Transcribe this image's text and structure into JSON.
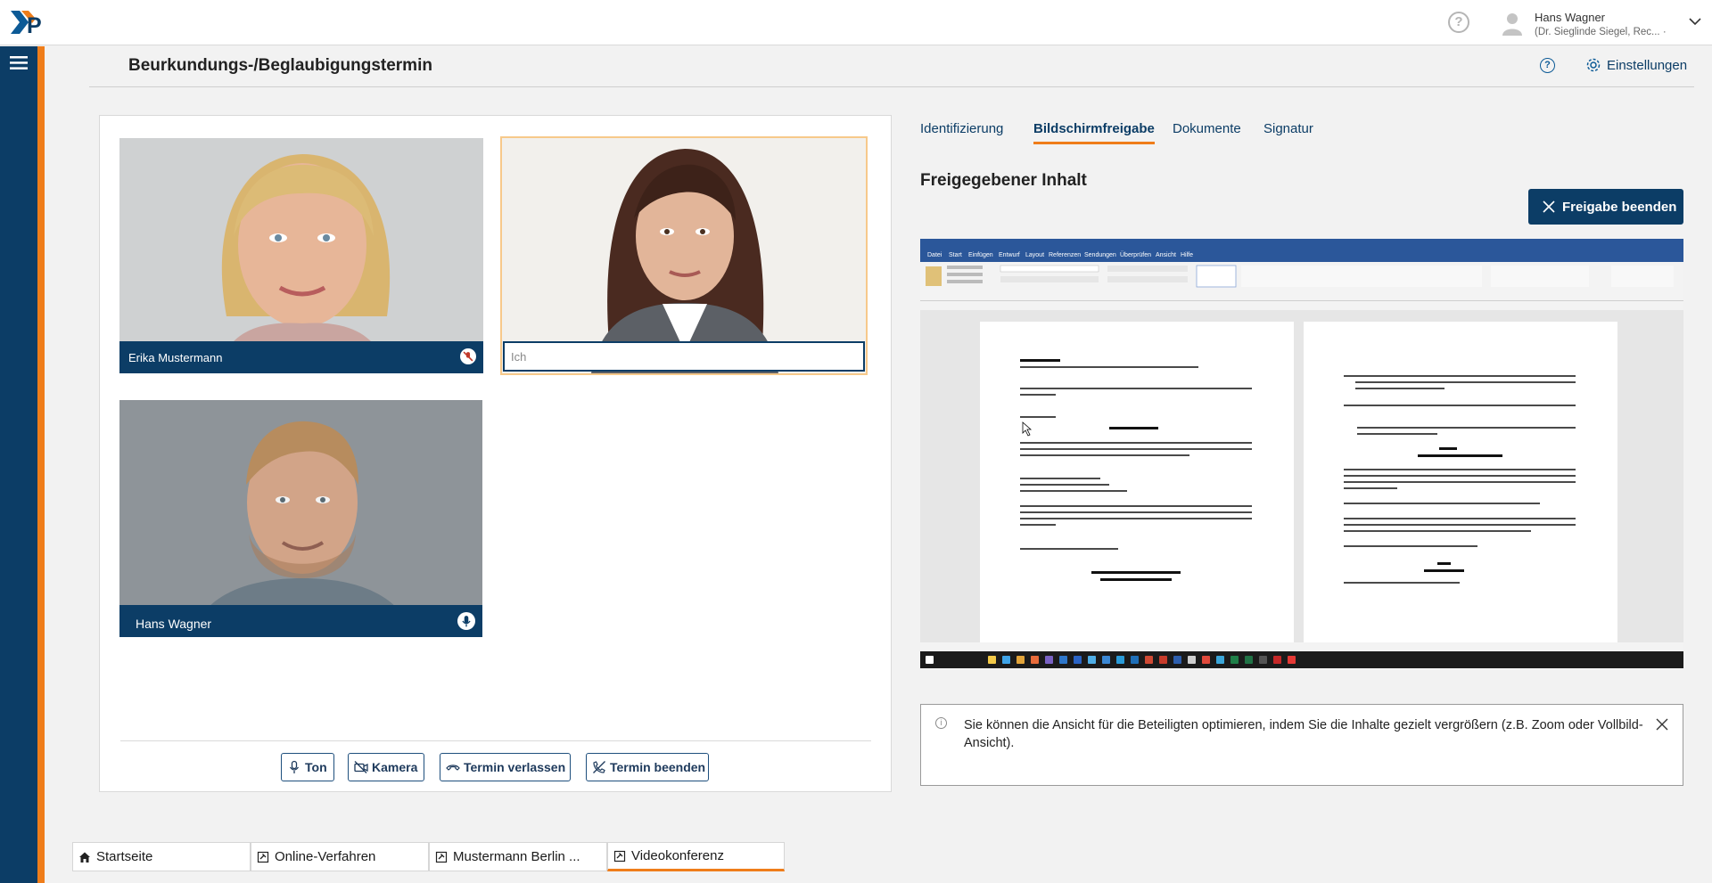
{
  "app": {
    "logo_text": "XP"
  },
  "user": {
    "name": "Hans Wagner",
    "subtitle": "(Dr. Sieglinde Siegel, Rec... ·"
  },
  "page": {
    "title": "Beurkundungs-/Beglaubigungstermin",
    "settings_label": "Einstellungen",
    "help_glyph": "?"
  },
  "participants": [
    {
      "name": "Erika Mustermann",
      "mic": "muted"
    },
    {
      "name": "Ich",
      "mic": "self"
    },
    {
      "name": "Hans Wagner",
      "mic": "on"
    }
  ],
  "controls": {
    "sound": "Ton",
    "camera": "Kamera",
    "leave": "Termin verlassen",
    "end": "Termin beenden"
  },
  "tabs": [
    {
      "label": "Identifizierung",
      "active": false
    },
    {
      "label": "Bildschirmfreigabe",
      "active": true
    },
    {
      "label": "Dokumente",
      "active": false
    },
    {
      "label": "Signatur",
      "active": false
    }
  ],
  "shared": {
    "title": "Freigegebener Inhalt",
    "end_share": "Freigabe beenden",
    "word_menu": [
      "Datei",
      "Start",
      "Einfügen",
      "Entwurf",
      "Layout",
      "Referenzen",
      "Sendungen",
      "Überprüfen",
      "Ansicht",
      "Hilfe"
    ]
  },
  "info": {
    "text": "Sie können die Ansicht für die Beteiligten optimieren, indem Sie die Inhalte gezielt vergrößern (z.B. Zoom oder Vollbild-Ansicht)."
  },
  "bottom_tabs": [
    {
      "label": "Startseite",
      "icon": "home-icon",
      "active": false
    },
    {
      "label": "Online-Verfahren",
      "icon": "gavel-icon",
      "active": false
    },
    {
      "label": "Mustermann Berlin ...",
      "icon": "gavel-icon",
      "active": false
    },
    {
      "label": "Videokonferenz",
      "icon": "gavel-icon",
      "active": true
    }
  ],
  "colors": {
    "primary": "#0c3d66",
    "accent": "#ef7d1a",
    "word_blue": "#2b579a"
  }
}
